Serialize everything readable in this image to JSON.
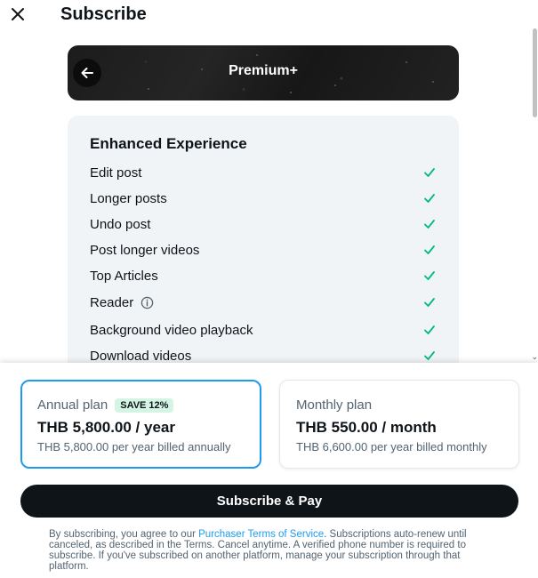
{
  "header": {
    "title": "Subscribe"
  },
  "banner": {
    "title": "Premium+"
  },
  "features": {
    "heading": "Enhanced Experience",
    "items": [
      {
        "label": "Edit post"
      },
      {
        "label": "Longer posts"
      },
      {
        "label": "Undo post"
      },
      {
        "label": "Post longer videos"
      },
      {
        "label": "Top Articles"
      },
      {
        "label": "Reader",
        "info": true
      },
      {
        "label": "Background video playback"
      },
      {
        "label": "Download videos"
      }
    ]
  },
  "plans": {
    "annual": {
      "name": "Annual plan",
      "badge": "SAVE 12%",
      "price": "THB 5,800.00 / year",
      "subtext": "THB 5,800.00 per year billed annually",
      "selected": true
    },
    "monthly": {
      "name": "Monthly plan",
      "price": "THB 550.00 / month",
      "subtext": "THB 6,600.00 per year billed monthly",
      "selected": false
    }
  },
  "pay_button": {
    "label": "Subscribe & Pay"
  },
  "legal": {
    "prefix": "By subscribing, you agree to our ",
    "link": "Purchaser Terms of Service",
    "suffix": ". Subscriptions auto-renew until canceled, as described in the Terms. Cancel anytime. A verified phone number is required to subscribe. If you've subscribed on another platform, manage your subscription through that platform."
  },
  "colors": {
    "accent": "#1d9bf0",
    "check": "#00ba7c",
    "dark": "#0f1419",
    "muted": "#536471"
  },
  "icons": {
    "close": "close-icon",
    "back": "arrow-left-icon",
    "check": "check-icon",
    "info": "info-icon"
  }
}
